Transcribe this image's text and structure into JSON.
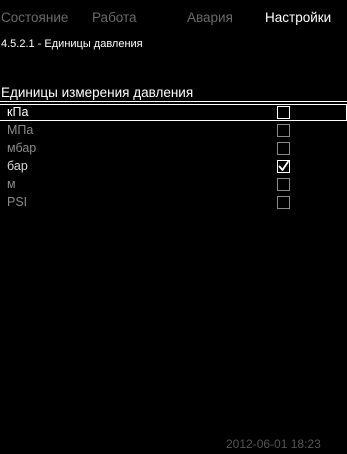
{
  "tabs": [
    {
      "label": "Состояние",
      "active": false
    },
    {
      "label": "Работа",
      "active": false
    },
    {
      "label": "Авария",
      "active": false
    },
    {
      "label": "Настройки",
      "active": true
    }
  ],
  "breadcrumb": "4.5.2.1 - Единицы давления",
  "section_title": "Единицы измерения давления",
  "options": [
    {
      "label": "кПа",
      "checked": false
    },
    {
      "label": "МПа",
      "checked": false
    },
    {
      "label": "мбар",
      "checked": false
    },
    {
      "label": "бар",
      "checked": true
    },
    {
      "label": "м",
      "checked": false
    },
    {
      "label": "PSI",
      "checked": false
    }
  ],
  "timestamp": "2012-06-01 18:23",
  "icons": {
    "checkbox_checked": "check-mark-icon"
  },
  "colors": {
    "background": "#000000",
    "active_text": "#ffffff",
    "inactive_tab": "#6a6a6a",
    "dim_text": "#8a8a8a",
    "timestamp": "#555555"
  }
}
